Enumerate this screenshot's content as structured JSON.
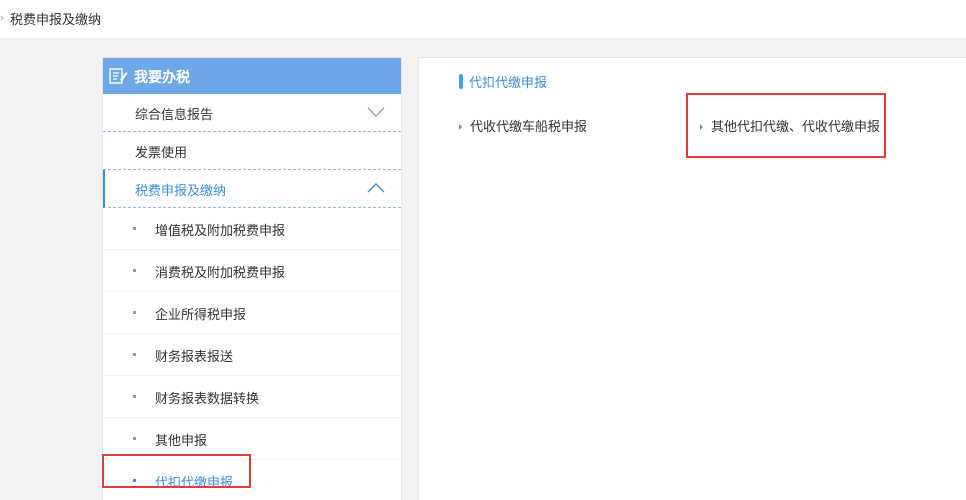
{
  "breadcrumb": {
    "text": "税费申报及缴纳"
  },
  "sidebar": {
    "header_title": "我要办税",
    "menu": [
      {
        "label": "综合信息报告",
        "chevron": "chevron-down-icon"
      },
      {
        "label": "发票使用"
      },
      {
        "label": "税费申报及缴纳",
        "chevron": "chevron-up-icon"
      }
    ],
    "sub_items": [
      {
        "label": "增值税及附加税费申报"
      },
      {
        "label": "消费税及附加税费申报"
      },
      {
        "label": "企业所得税申报"
      },
      {
        "label": "财务报表报送"
      },
      {
        "label": "财务报表数据转换"
      },
      {
        "label": "其他申报"
      },
      {
        "label": "代扣代缴申报"
      }
    ]
  },
  "content": {
    "section_title": "代扣代缴申报",
    "links": [
      {
        "label": "代收代缴车船税申报"
      },
      {
        "label": "其他代扣代缴、代收代缴申报"
      }
    ]
  },
  "colors": {
    "accent": "#3d8ee0",
    "header_blue": "#6fa8e8",
    "highlight_red": "#e23b3b"
  }
}
